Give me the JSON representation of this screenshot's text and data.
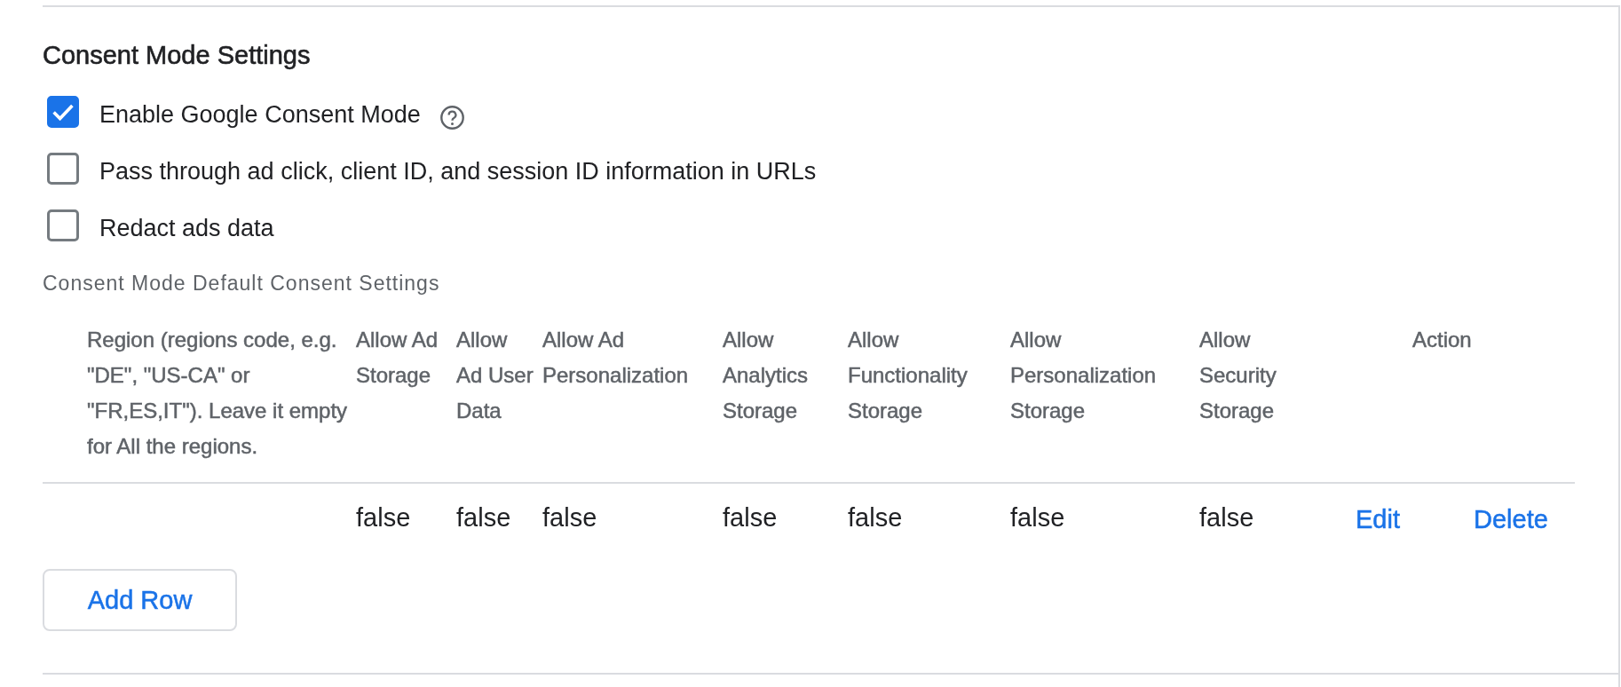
{
  "section": {
    "title": "Consent Mode Settings"
  },
  "options": [
    {
      "label": "Enable Google Consent Mode",
      "checked": true,
      "help": true
    },
    {
      "label": "Pass through ad click, client ID, and session ID information in URLs",
      "checked": false,
      "help": false
    },
    {
      "label": "Redact ads data",
      "checked": false,
      "help": false
    }
  ],
  "defaults_table": {
    "caption": "Consent Mode Default Consent Settings",
    "columns": [
      "Region (regions code, e.g. \"DE\", \"US-CA\" or \"FR,ES,IT\"). Leave it empty for All the regions.",
      "Allow Ad Storage",
      "Allow Ad User Data",
      "Allow Ad Personalization",
      "Allow Analytics Storage",
      "Allow Functionality Storage",
      "Allow Personalization Storage",
      "Allow Security Storage",
      "Action"
    ],
    "rows": [
      {
        "values": [
          "false",
          "false",
          "false",
          "false",
          "false",
          "false",
          "false"
        ],
        "actions": [
          "Edit",
          "Delete"
        ]
      }
    ]
  },
  "add_button": {
    "label": "Add Row"
  }
}
